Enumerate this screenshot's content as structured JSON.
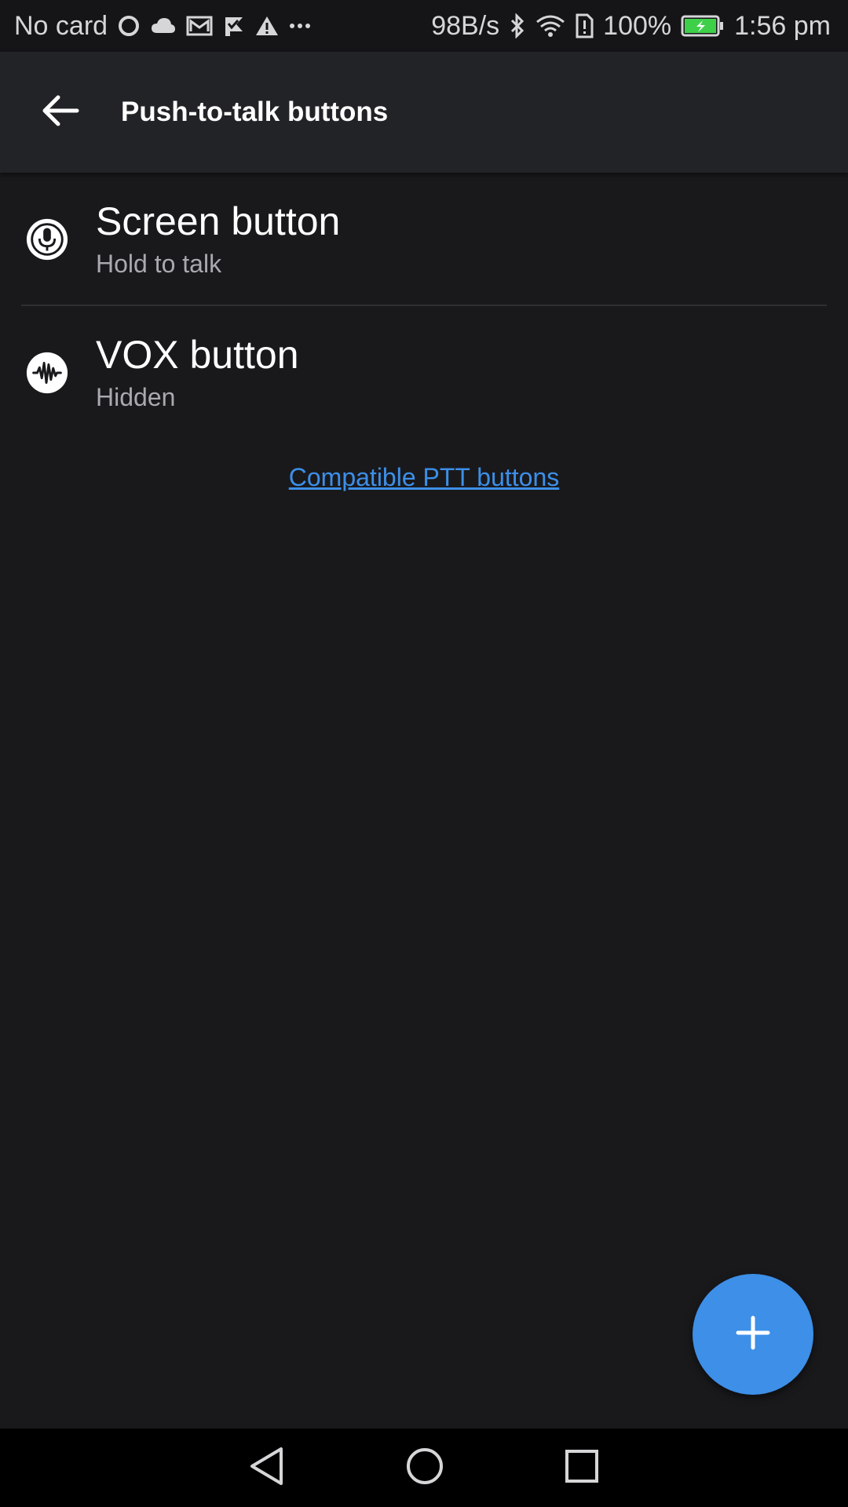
{
  "status_bar": {
    "carrier": "No card",
    "net_speed": "98B/s",
    "battery_percent": "100%",
    "time": "1:56 pm",
    "left_icons": [
      "circle-icon",
      "cloud-icon",
      "gmail-icon",
      "check-flag-icon",
      "warning-icon",
      "more-dots-icon"
    ],
    "right_icons": [
      "bluetooth-icon",
      "wifi-icon",
      "sim-alert-icon",
      "battery-charging-icon"
    ]
  },
  "app_bar": {
    "title": "Push-to-talk buttons",
    "back_icon": "back-arrow-icon"
  },
  "items": [
    {
      "title": "Screen button",
      "subtitle": "Hold to talk",
      "icon": "microphone-icon"
    },
    {
      "title": "VOX button",
      "subtitle": "Hidden",
      "icon": "waveform-icon"
    }
  ],
  "link": {
    "label": "Compatible PTT buttons"
  },
  "fab": {
    "icon": "plus-icon"
  },
  "nav": {
    "icons": [
      "nav-back-icon",
      "nav-home-icon",
      "nav-recents-icon"
    ]
  },
  "colors": {
    "background": "#19191c",
    "app_bar": "#222326",
    "accent": "#3d8fe8",
    "battery_green": "#3fd04a"
  }
}
